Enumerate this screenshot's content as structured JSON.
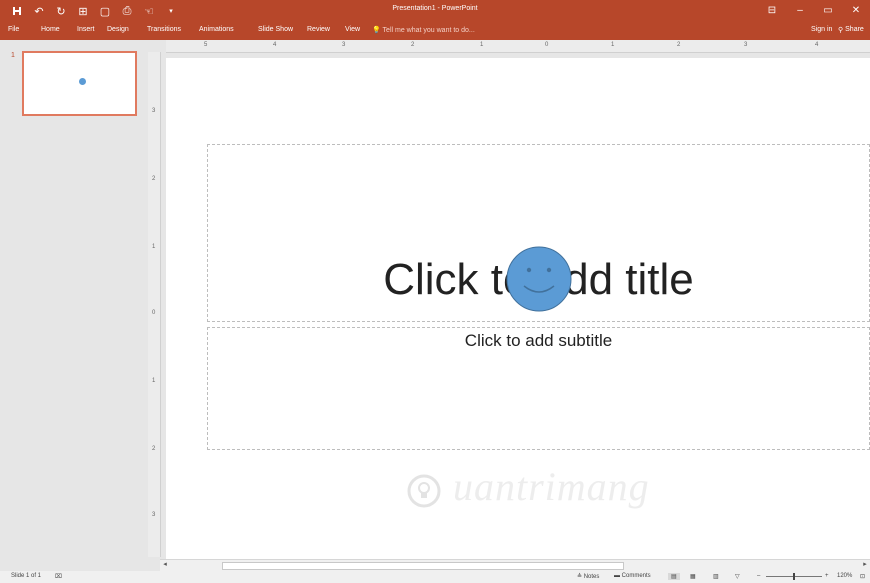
{
  "titlebar": {
    "title": "Presentation1 - PowerPoint",
    "qat": [
      {
        "icon": "save-icon",
        "glyph": "🖫"
      },
      {
        "icon": "undo-icon",
        "glyph": "↶"
      },
      {
        "icon": "redo-icon",
        "glyph": "↻"
      },
      {
        "icon": "present-from-start-icon",
        "glyph": "⊞"
      },
      {
        "icon": "new-slide-icon",
        "glyph": "▢"
      },
      {
        "icon": "quick-print-icon",
        "glyph": "⎙"
      },
      {
        "icon": "touch-mode-icon",
        "glyph": "☜"
      },
      {
        "icon": "customize-qat-icon",
        "glyph": "▾"
      }
    ],
    "window_controls": [
      "ribbon-display-icon",
      "minimize-icon",
      "maximize-icon",
      "close-icon"
    ]
  },
  "ribbon": {
    "tabs": [
      "File",
      "Home",
      "Insert",
      "Design",
      "Transitions",
      "Animations",
      "Slide Show",
      "Review",
      "View"
    ],
    "tell_me": "Tell me what you want to do...",
    "sign_in": "Sign in",
    "share": "Share"
  },
  "ruler": {
    "h_numbers": [
      "5",
      "4",
      "3",
      "2",
      "1",
      "0",
      "1",
      "2",
      "3",
      "4"
    ],
    "v_numbers": [
      "3",
      "2",
      "1",
      "0",
      "1",
      "2",
      "3"
    ]
  },
  "thumbnails": [
    {
      "number": "1"
    }
  ],
  "slide": {
    "title_placeholder": "Click to add title",
    "subtitle_placeholder": "Click to add subtitle",
    "shape": "smiley-face",
    "shape_color": "#5b9bd5",
    "watermark": "uantrimang"
  },
  "status": {
    "slide_count": "Slide 1 of 1",
    "notes": "Notes",
    "comments": "Comments",
    "zoom": "120%"
  },
  "colors": {
    "accent": "#b7472a",
    "selection": "#e07a5f"
  }
}
